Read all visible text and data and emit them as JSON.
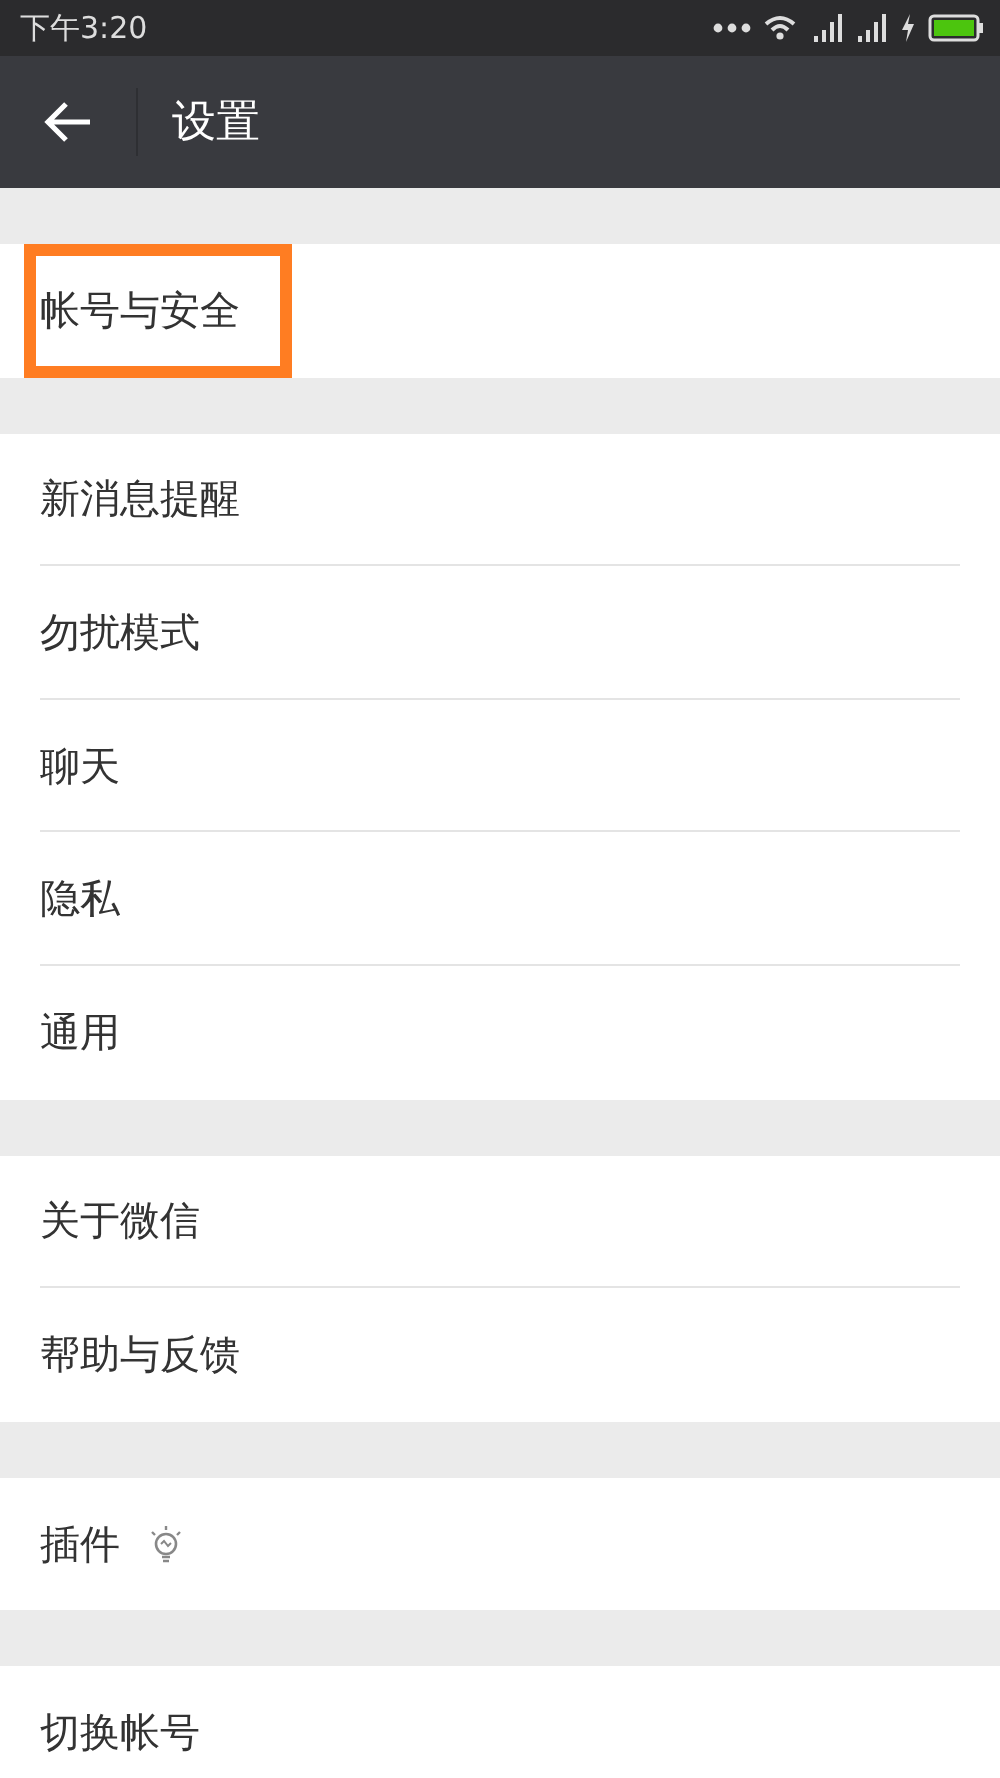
{
  "status_bar": {
    "time": "下午3:20"
  },
  "header": {
    "title": "设置"
  },
  "groups": [
    {
      "items": [
        {
          "label": "帐号与安全",
          "kind": "plain",
          "highlighted": true
        }
      ]
    },
    {
      "items": [
        {
          "label": "新消息提醒",
          "kind": "plain",
          "highlighted": false
        },
        {
          "label": "勿扰模式",
          "kind": "plain",
          "highlighted": false
        },
        {
          "label": "聊天",
          "kind": "plain",
          "highlighted": false
        },
        {
          "label": "隐私",
          "kind": "plain",
          "highlighted": false
        },
        {
          "label": "通用",
          "kind": "plain",
          "highlighted": false
        }
      ]
    },
    {
      "items": [
        {
          "label": "关于微信",
          "kind": "plain",
          "highlighted": false
        },
        {
          "label": "帮助与反馈",
          "kind": "plain",
          "highlighted": false
        }
      ]
    },
    {
      "items": [
        {
          "label": "插件",
          "kind": "bulb",
          "highlighted": false
        }
      ]
    },
    {
      "items": [
        {
          "label": "切换帐号",
          "kind": "plain",
          "highlighted": false
        }
      ]
    }
  ]
}
